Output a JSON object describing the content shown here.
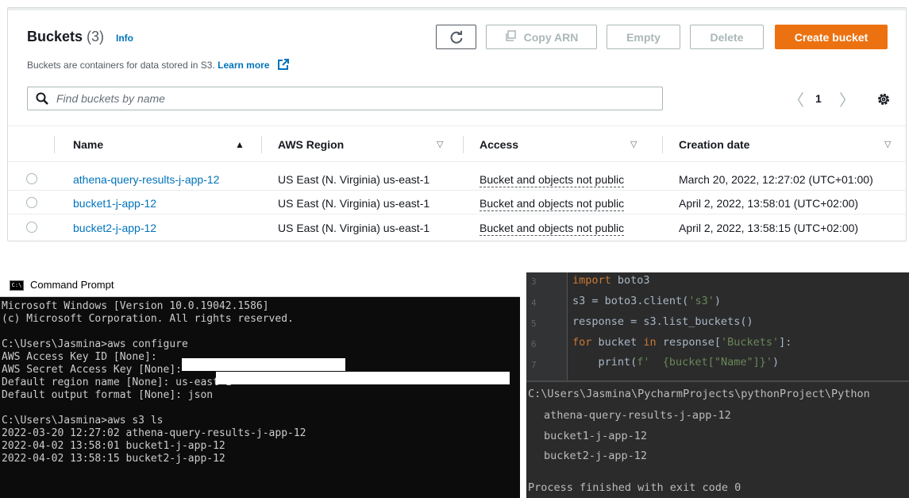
{
  "s3": {
    "title": "Buckets",
    "count": "(3)",
    "info": "Info",
    "description": "Buckets are containers for data stored in S3.",
    "learn_more": "Learn more",
    "buttons": {
      "refresh_icon": "refresh-icon",
      "copy_arn": "Copy ARN",
      "empty": "Empty",
      "delete": "Delete",
      "create": "Create bucket"
    },
    "search_placeholder": "Find buckets by name",
    "page": "1",
    "columns": [
      "Name",
      "AWS Region",
      "Access",
      "Creation date"
    ],
    "rows": [
      {
        "name": "athena-query-results-j-app-12",
        "region": "US East (N. Virginia) us-east-1",
        "access": "Bucket and objects not public",
        "created": "March 20, 2022, 12:27:02 (UTC+01:00)"
      },
      {
        "name": "bucket1-j-app-12",
        "region": "US East (N. Virginia) us-east-1",
        "access": "Bucket and objects not public",
        "created": "April 2, 2022, 13:58:01 (UTC+02:00)"
      },
      {
        "name": "bucket2-j-app-12",
        "region": "US East (N. Virginia) us-east-1",
        "access": "Bucket and objects not public",
        "created": "April 2, 2022, 13:58:15 (UTC+02:00)"
      }
    ],
    "colors": {
      "accent": "#ec7211",
      "link": "#0073bb"
    }
  },
  "cmd": {
    "title": "Command Prompt",
    "lines": [
      "Microsoft Windows [Version 10.0.19042.1586]",
      "(c) Microsoft Corporation. All rights reserved.",
      "",
      "C:\\Users\\Jasmina>aws configure",
      "AWS Access Key ID [None]:",
      "AWS Secret Access Key [None]:",
      "Default region name [None]: us-east-1",
      "Default output format [None]: json",
      "",
      "C:\\Users\\Jasmina>aws s3 ls",
      "2022-03-20 12:27:02 athena-query-results-j-app-12",
      "2022-04-02 13:58:01 bucket1-j-app-12",
      "2022-04-02 13:58:15 bucket2-j-app-12"
    ]
  },
  "pycharm": {
    "line_numbers": [
      "3",
      "4",
      "5",
      "6",
      "7"
    ],
    "code": {
      "l1_kw": "import",
      "l1_rest": " boto3",
      "l2": "s3 = boto3.client(",
      "l2_str": "'s3'",
      "l2_end": ")",
      "l3": "response = s3.list_buckets()",
      "l4_kw": "for",
      "l4_a": " bucket ",
      "l4_kw2": "in",
      "l4_b": " response[",
      "l4_str": "'Buckets'",
      "l4_c": "]:",
      "l5_a": "    print(",
      "l5_str": "f'  {bucket[\"Name\"]}'",
      "l5_b": ")"
    },
    "run_path": "C:\\Users\\Jasmina\\PycharmProjects\\pythonProject\\Python",
    "output": [
      "athena-query-results-j-app-12",
      "bucket1-j-app-12",
      "bucket2-j-app-12"
    ],
    "exit_msg": "Process finished with exit code 0"
  }
}
